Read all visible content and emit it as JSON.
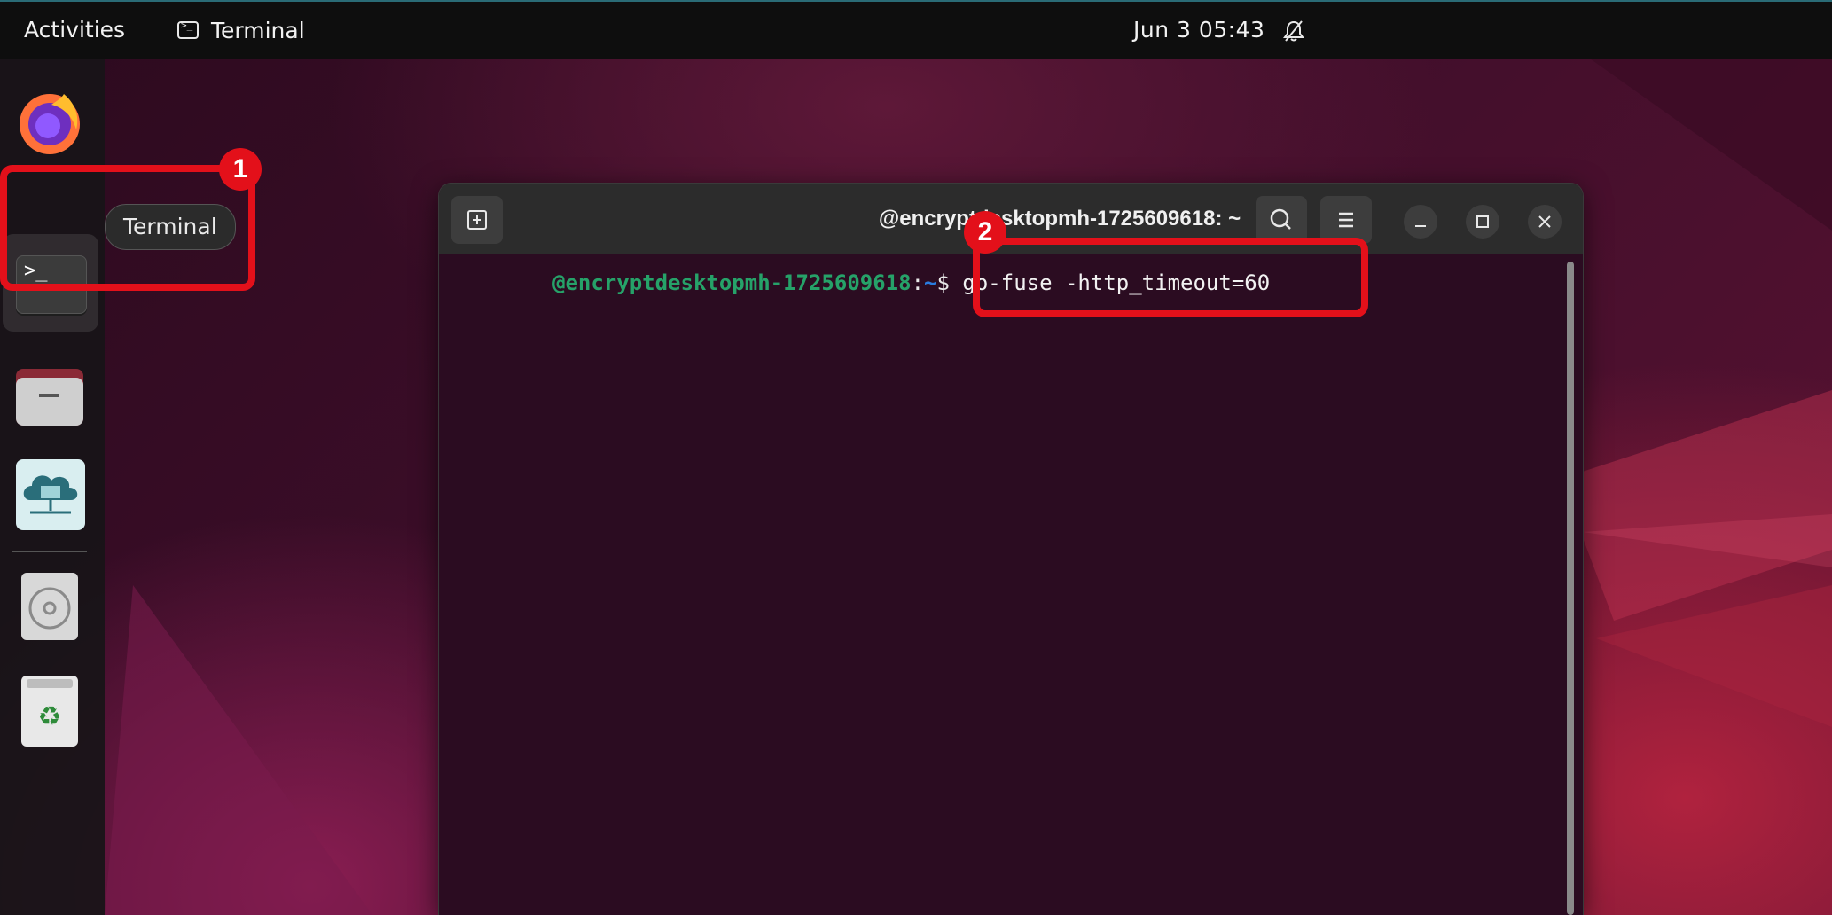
{
  "top_bar": {
    "activities_label": "Activities",
    "app_name": "Terminal",
    "clock": "Jun 3  05:43",
    "notifications_icon": "bell-muted-icon"
  },
  "dock": {
    "items": [
      {
        "name": "Firefox",
        "icon": "firefox-icon"
      },
      {
        "name": "Terminal",
        "icon": "terminal-icon"
      },
      {
        "name": "Files",
        "icon": "folder-icon"
      },
      {
        "name": "Cloud",
        "icon": "cloud-network-icon"
      },
      {
        "name": "Disc",
        "icon": "disc-icon"
      },
      {
        "name": "Trash",
        "icon": "trash-icon"
      }
    ],
    "tooltip": "Terminal"
  },
  "annotations": {
    "step_1": "1",
    "step_2": "2",
    "highlight_color": "#e3101a"
  },
  "terminal": {
    "title": "@encryptdesktopmh-1725609618: ~",
    "prompt_user": "@encryptdesktopmh-1725609618",
    "prompt_sep": ":",
    "prompt_path": "~",
    "prompt_dollar": "$ ",
    "command": "go-fuse -http_timeout=60",
    "colors": {
      "user": "#26a269",
      "path": "#2a7bde",
      "background": "#2b0c21"
    }
  }
}
